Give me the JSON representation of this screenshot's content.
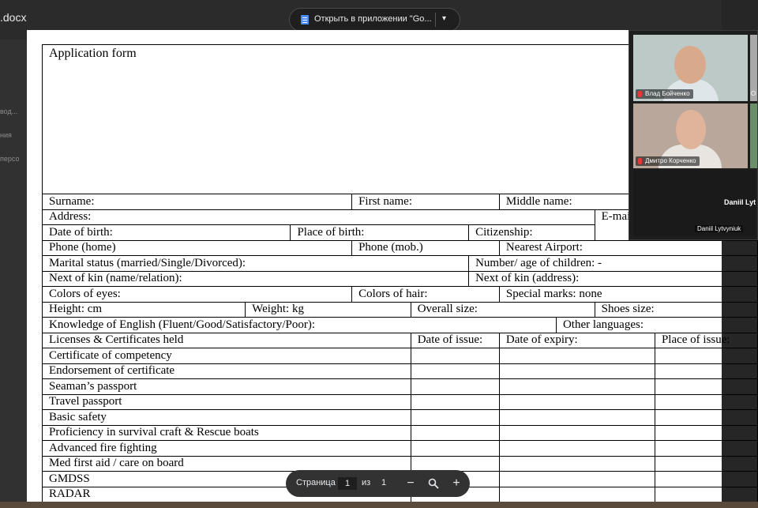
{
  "app": {
    "filename": ".docx",
    "open_button_label": "Открыть в приложении \"Go...",
    "left_panel_fragments": [
      "вод...",
      "ния",
      "персо"
    ]
  },
  "form": {
    "title": "Application form",
    "rows": {
      "surname": "Surname:",
      "first_name": "First name:",
      "middle_name": "Middle name:",
      "address": "Address:",
      "email": "E-mail:",
      "dob": "Date of birth:",
      "pob": "Place of birth:",
      "citizenship": "Citizenship:",
      "phone_home": "Phone (home)",
      "phone_mob": "Phone (mob.)",
      "nearest_airport": "Nearest Airport:",
      "marital": "Marital status (married/Single/Divorced):",
      "children": "Number/ age of children: -",
      "kin_name": "Next of kin (name/relation):",
      "kin_address": "Next of kin (address):",
      "eyes": "Colors of eyes:",
      "hair": "Colors of hair:",
      "marks": "Special marks: none",
      "height": "Height:   cm",
      "weight": "Weight:  kg",
      "overall": "Overall size:",
      "shoes": "Shoes size:",
      "english": "Knowledge of English (Fluent/Good/Satisfactory/Poor):",
      "other_lang": "Other languages:"
    },
    "cert_headers": [
      "Licenses & Certificates held",
      "Date of issue:",
      "Date of expiry:",
      "Place of issue:"
    ],
    "certificates": [
      "Certificate of competency",
      "Endorsement of certificate",
      "Seaman’s passport",
      "Travel passport",
      "Basic safety",
      "Proficiency in survival craft & Rescue boats",
      "Advanced fire fighting",
      "Med first aid / care on board",
      "GMDSS",
      "RADAR"
    ]
  },
  "video_call": {
    "participants": [
      {
        "name": "Влад Бойченко"
      },
      {
        "name": "Дмитро Корченко"
      },
      {
        "name": "Daniil Lytv",
        "label": "Daniil Lytvyniuk"
      }
    ],
    "edge_fragment": "O"
  },
  "pager": {
    "page_label": "Страница",
    "current_page": "1",
    "of_label": "из",
    "total_pages": "1",
    "zoom_out": "−",
    "zoom_in": "+"
  },
  "colors": {
    "background": "#2b2b2b",
    "paper": "#ffffff",
    "accent_doc": "#4c8bf5",
    "muted_mic": "#e53935"
  }
}
